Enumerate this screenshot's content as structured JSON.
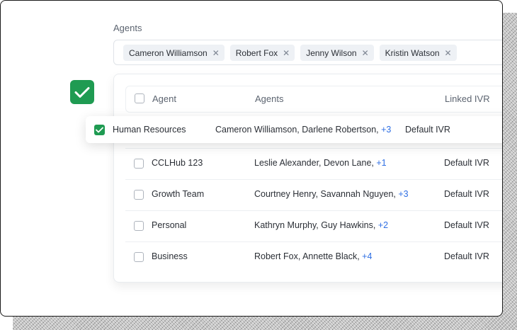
{
  "agents_field": {
    "label": "Agents",
    "tags": [
      {
        "name": "Cameron Williamson",
        "remove": "✕"
      },
      {
        "name": "Robert Fox",
        "remove": "✕"
      },
      {
        "name": "Jenny Wilson",
        "remove": "✕"
      },
      {
        "name": "Kristin Watson",
        "remove": "✕"
      }
    ]
  },
  "table": {
    "headers": {
      "col1": "Agent",
      "col2": "Agents",
      "col3": "Linked IVR"
    },
    "selected_row": {
      "checked": true,
      "agent": "Human Resources",
      "agents": "Cameron Williamson, Darlene Robertson, ",
      "more": "+3",
      "ivr": "Default IVR"
    },
    "rows": [
      {
        "agent": "CCLHub 123",
        "agents": "Leslie Alexander, Devon Lane, ",
        "more": "+1",
        "ivr": "Default IVR"
      },
      {
        "agent": "Growth Team",
        "agents": "Courtney Henry, Savannah Nguyen, ",
        "more": "+3",
        "ivr": "Default IVR"
      },
      {
        "agent": "Personal",
        "agents": "Kathryn Murphy, Guy Hawkins, ",
        "more": "+2",
        "ivr": "Default IVR"
      },
      {
        "agent": "Business",
        "agents": "Robert Fox, Annette Black, ",
        "more": "+4",
        "ivr": "Default IVR"
      }
    ]
  },
  "colors": {
    "accent_green": "#1f9b52",
    "link_blue": "#2f6fe4"
  },
  "icons": {
    "selection_badge": "check-icon",
    "tag_remove": "close-icon"
  }
}
